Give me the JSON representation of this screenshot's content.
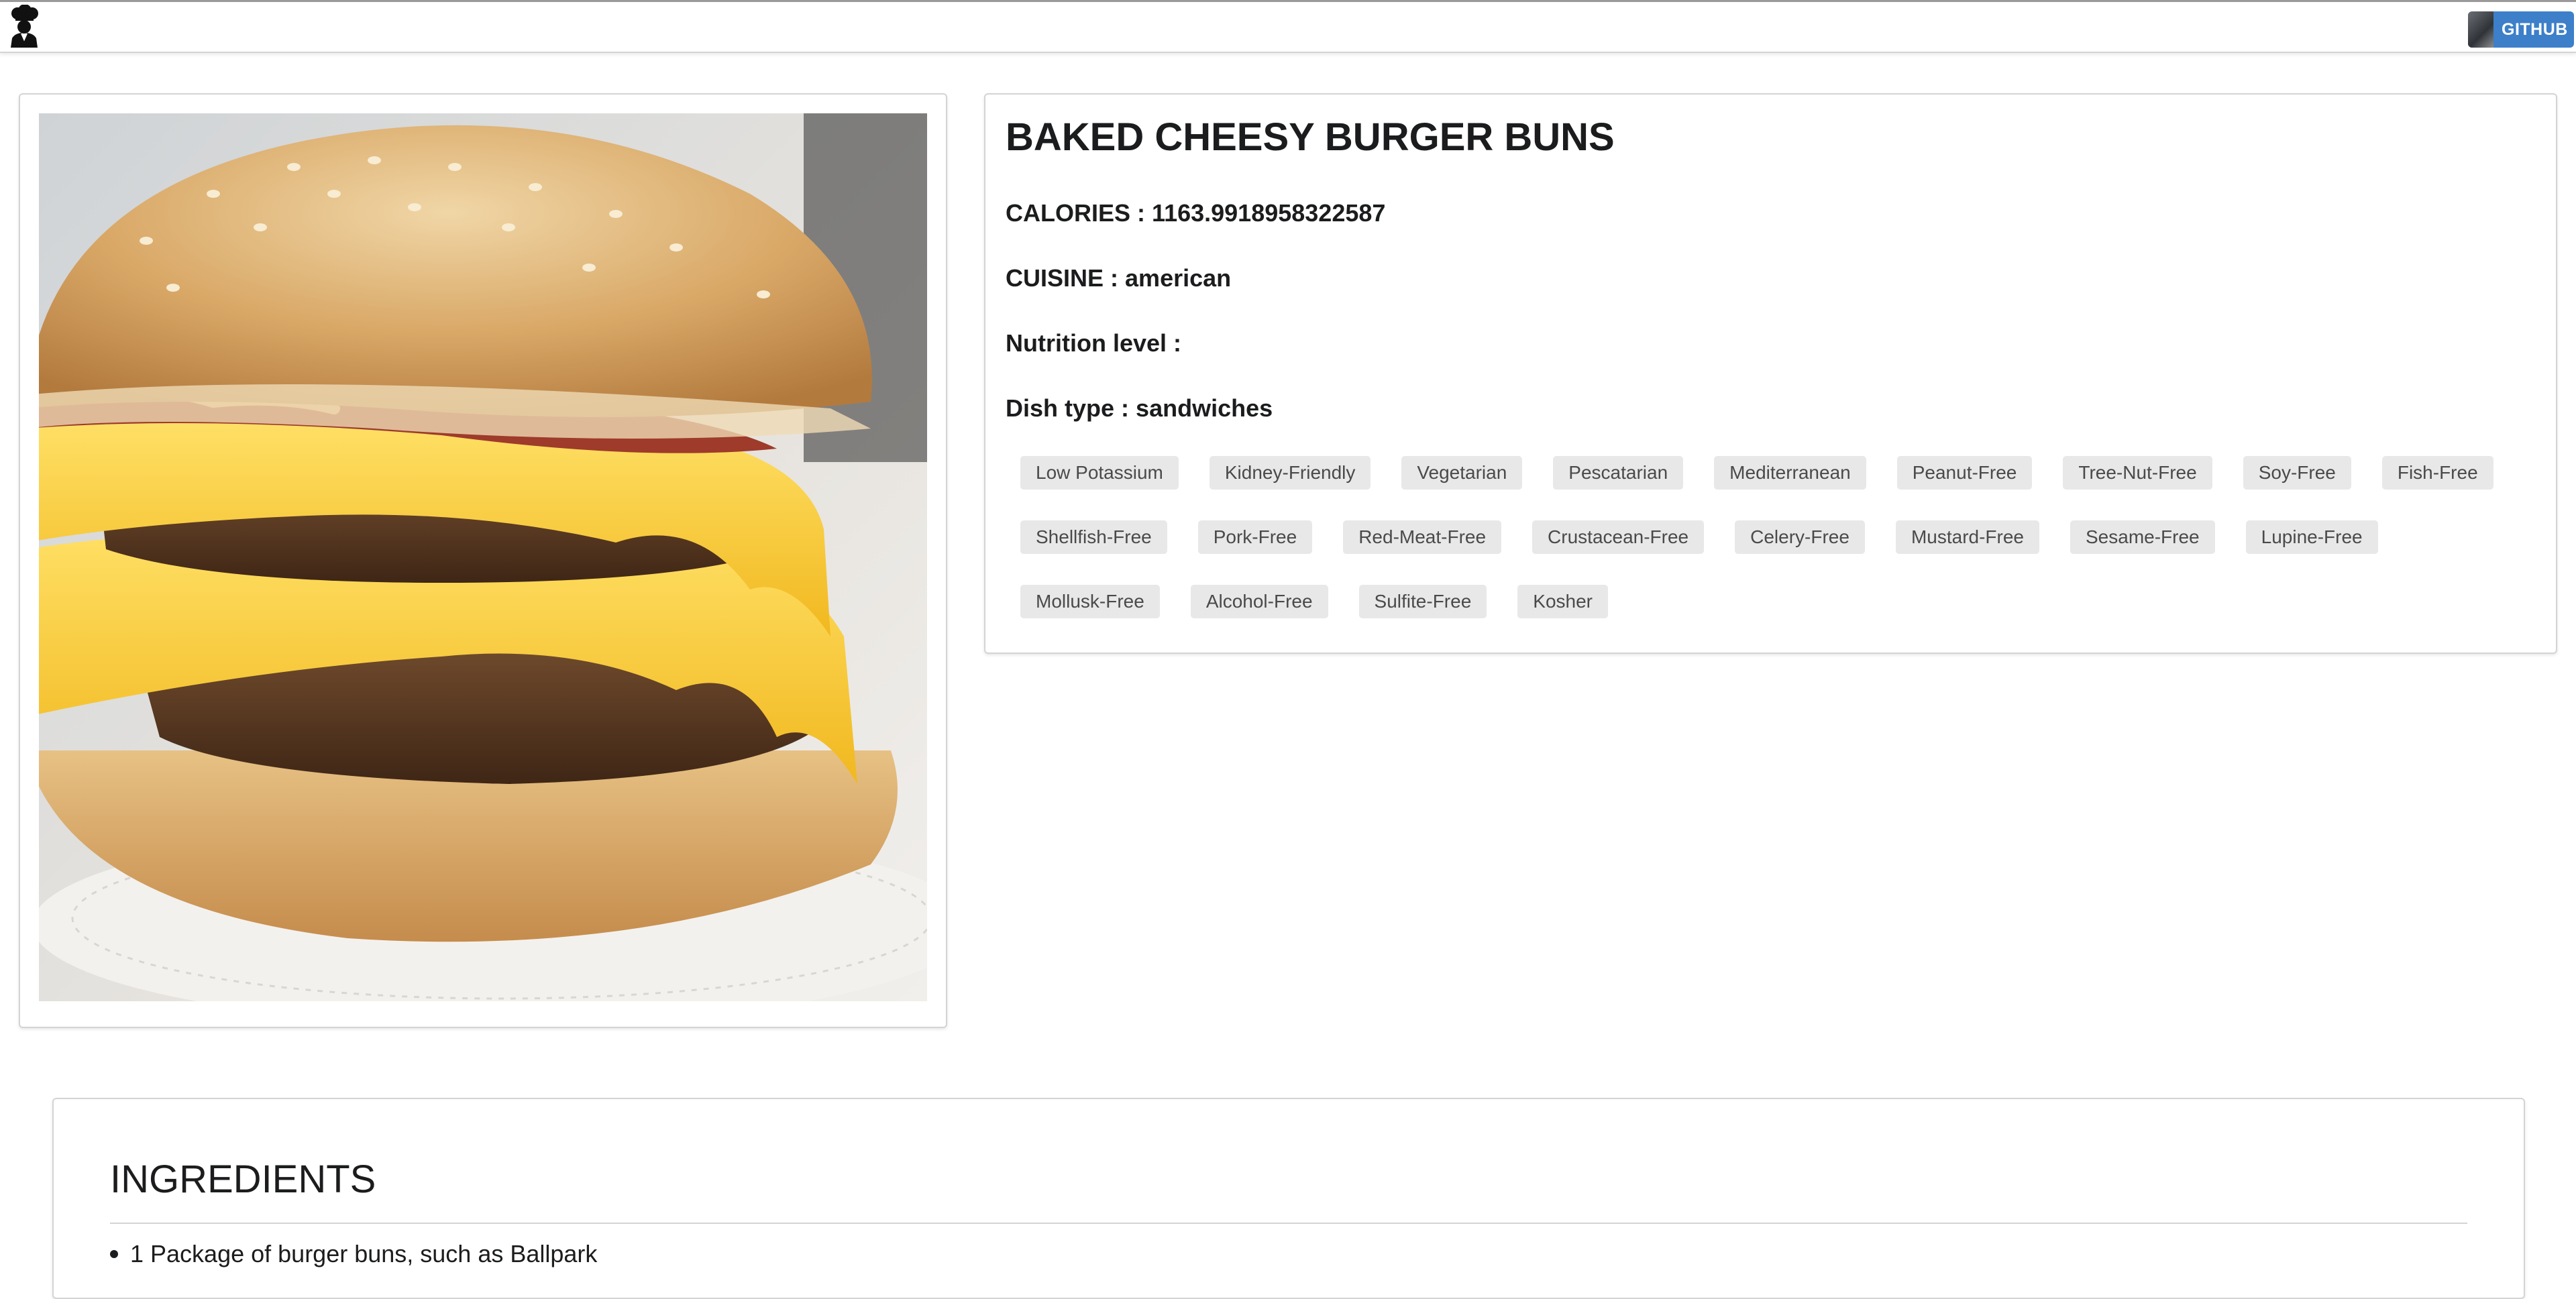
{
  "header": {
    "logo_icon": "chef-icon",
    "github_label": "GITHUB",
    "accent_color": "#3d7fc9"
  },
  "recipe": {
    "title": "BAKED CHEESY BURGER BUNS",
    "calories_label": "CALORIES :",
    "calories_value": "1163.9918958322587",
    "cuisine_label": "CUISINE :",
    "cuisine_value": "american",
    "nutrition_label": "Nutrition level :",
    "nutrition_value": "",
    "dish_type_label": "Dish type :",
    "dish_type_value": "sandwiches",
    "tag_rows": [
      [
        "Low Potassium",
        "Kidney-Friendly",
        "Vegetarian",
        "Pescatarian",
        "Mediterranean",
        "Peanut-Free",
        "Tree-Nut-Free",
        "Soy-Free",
        "Fish-Free"
      ],
      [
        "Shellfish-Free",
        "Pork-Free",
        "Red-Meat-Free",
        "Crustacean-Free",
        "Celery-Free",
        "Mustard-Free",
        "Sesame-Free",
        "Lupine-Free"
      ],
      [
        "Mollusk-Free",
        "Alcohol-Free",
        "Sulfite-Free",
        "Kosher"
      ]
    ]
  },
  "ingredients": {
    "title": "INGREDIENTS",
    "items": [
      "1 Package of burger buns, such as Ballpark"
    ]
  }
}
